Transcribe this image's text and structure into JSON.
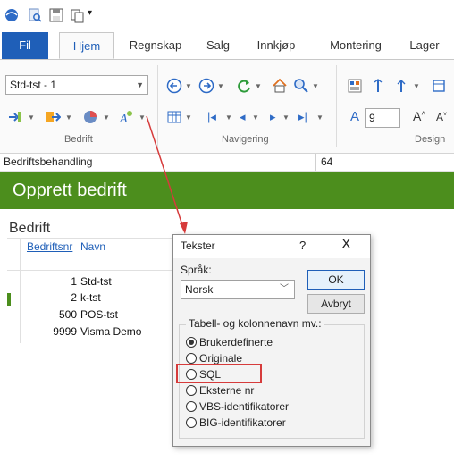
{
  "tabs": [
    "Fil",
    "Hjem",
    "Regnskap",
    "Salg",
    "Innkjøp",
    "Montering",
    "Lager"
  ],
  "ribbon": {
    "company_combo_value": "Std-tst - 1",
    "font_size_value": "9",
    "group_labels": [
      "Bedrift",
      "Navigering",
      "Design"
    ]
  },
  "status": {
    "left_text": "Bedriftsbehandling",
    "number": "64"
  },
  "header": {
    "title": "Opprett bedrift"
  },
  "content": {
    "section_title": "Bedrift",
    "columns": [
      "Bedriftsnr",
      "Navn"
    ],
    "rows": [
      {
        "nr": "1",
        "name": "Std-tst"
      },
      {
        "nr": "2",
        "name": "k-tst"
      },
      {
        "nr": "500",
        "name": "POS-tst"
      },
      {
        "nr": "9999",
        "name": "Visma Demo"
      }
    ]
  },
  "dialog": {
    "title": "Tekster",
    "help": "?",
    "close": "X",
    "lang_label": "Språk:",
    "lang_value": "Norsk",
    "ok_label": "OK",
    "cancel_label": "Avbryt",
    "group_label": "Tabell- og kolonnenavn mv.:",
    "options": [
      "Brukerdefinerte",
      "Originale",
      "SQL",
      "Eksterne nr",
      "VBS-identifikatorer",
      "BIG-identifikatorer"
    ],
    "selected": "Brukerdefinerte"
  },
  "colors": {
    "accent_blue": "#1f5fb8",
    "header_green": "#4c8e1d",
    "annotation_red": "#d63b3b"
  }
}
